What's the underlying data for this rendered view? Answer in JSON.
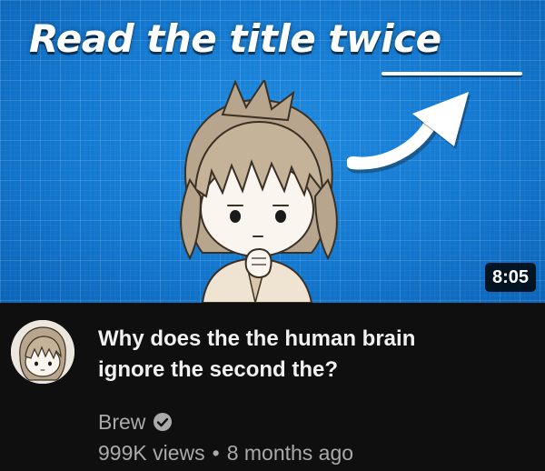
{
  "thumbnail": {
    "overlay_text_part1": "Read the title ",
    "overlay_text_part2": "twice",
    "duration": "8:05"
  },
  "video": {
    "title_line1": "Why does the the human brain",
    "title_line2": "ignore the second the?"
  },
  "channel": {
    "name": "Brew",
    "verified_icon": "verified-check-icon"
  },
  "meta": {
    "views": "999K views",
    "separator": "•",
    "age": "8 months ago"
  },
  "colors": {
    "thumbnail_blue": "#1378cf",
    "background": "#0f0f0f",
    "title_text": "#f1f1f1",
    "secondary_text": "#aaaaaa"
  }
}
